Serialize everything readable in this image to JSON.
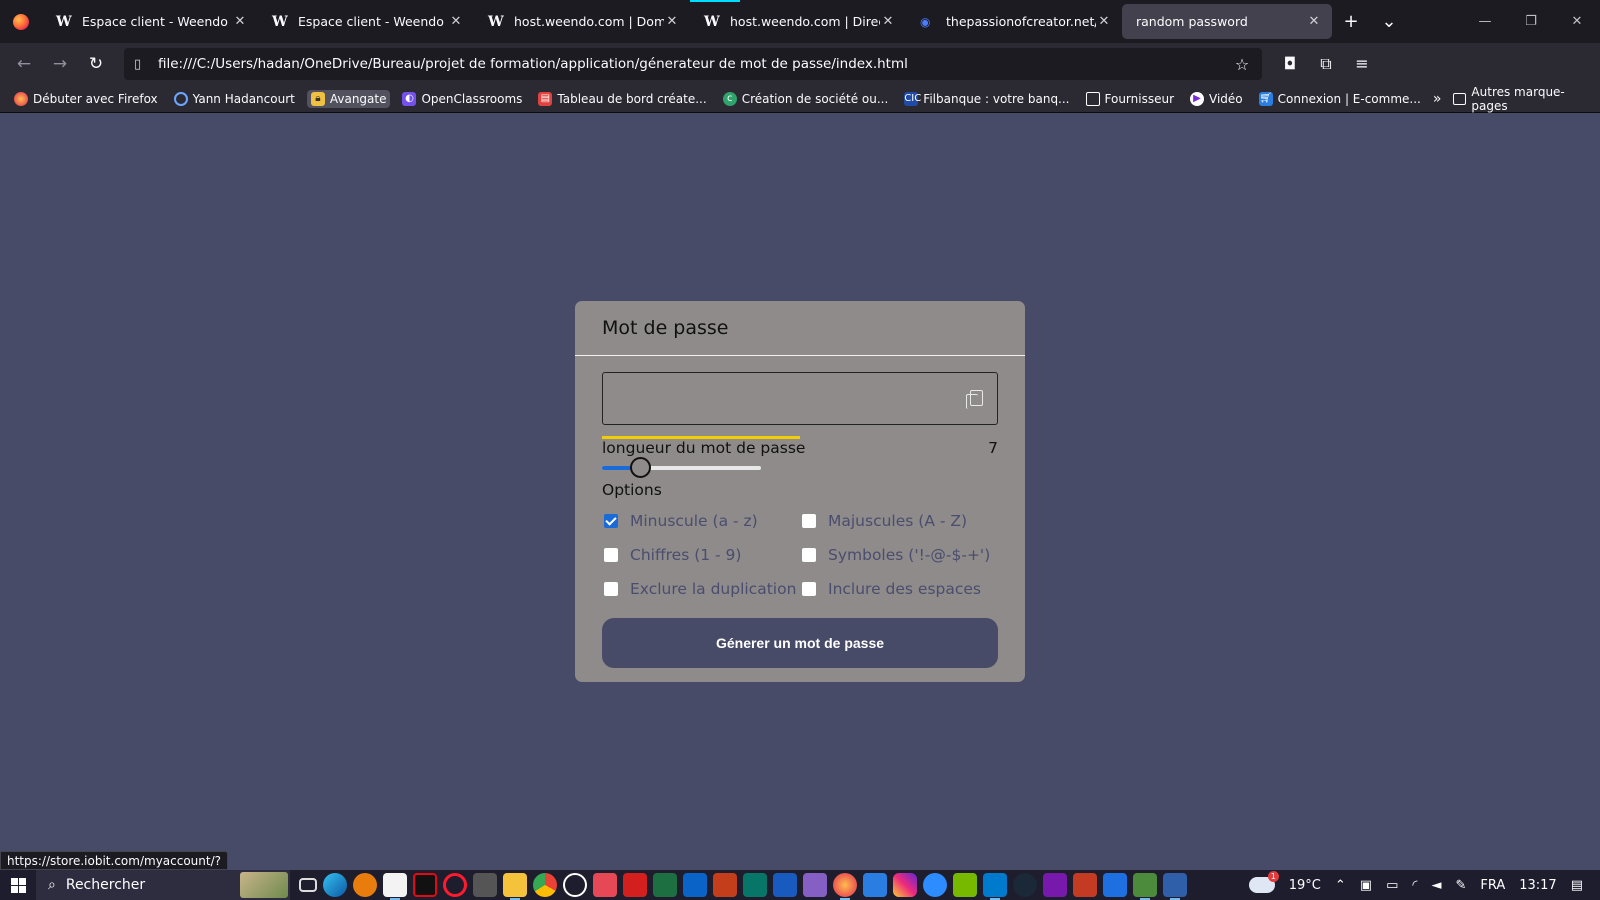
{
  "browser": {
    "tabs": [
      {
        "favicon": "W",
        "title": "Espace client - Weendo",
        "active": false
      },
      {
        "favicon": "W",
        "title": "Espace client - Weendo",
        "active": false
      },
      {
        "favicon": "W",
        "title": "host.weendo.com | Domain M",
        "active": false
      },
      {
        "favicon": "W",
        "title": "host.weendo.com | DirectAdm",
        "active": false
      },
      {
        "favicon": "globe",
        "title": "thepassionofcreator.net/portf",
        "active": false
      },
      {
        "favicon": "",
        "title": "random password",
        "active": true
      }
    ],
    "url": "file:///C:/Users/hadan/OneDrive/Bureau/projet de formation/application/génerateur de mot de passe/index.html",
    "bookmarks": [
      "Débuter avec Firefox",
      "Yann Hadancourt",
      "Avangate",
      "OpenClassrooms",
      "Tableau de bord créate...",
      "Création de société ou...",
      "Filbanque : votre banq...",
      "Fournisseur",
      "Vidéo",
      "Connexion | E-comme..."
    ],
    "other_bookmarks": "Autres marque-pages",
    "status_url": "https://store.iobit.com/myaccount/?"
  },
  "app": {
    "title": "Mot de passe",
    "password_value": "",
    "length_label": "longueur du mot de passe",
    "length_value": "7",
    "length_fraction": 0.24,
    "options_title": "Options",
    "options": [
      {
        "label": "Minuscule (a - z)",
        "checked": true
      },
      {
        "label": "Majuscules (A - Z)",
        "checked": false
      },
      {
        "label": "Chiffres (1 - 9)",
        "checked": false
      },
      {
        "label": "Symboles ('!-@-$-+')",
        "checked": false
      },
      {
        "label": "Exclure la duplication",
        "checked": false
      },
      {
        "label": "Inclure des espaces",
        "checked": false
      }
    ],
    "generate_label": "Génerer un mot de passe",
    "accent": "#1a6ad8",
    "strength_color": "#f2cd04"
  },
  "taskbar": {
    "search_placeholder": "Rechercher",
    "weather": "19°C",
    "language": "FRA",
    "time": "13:17"
  }
}
